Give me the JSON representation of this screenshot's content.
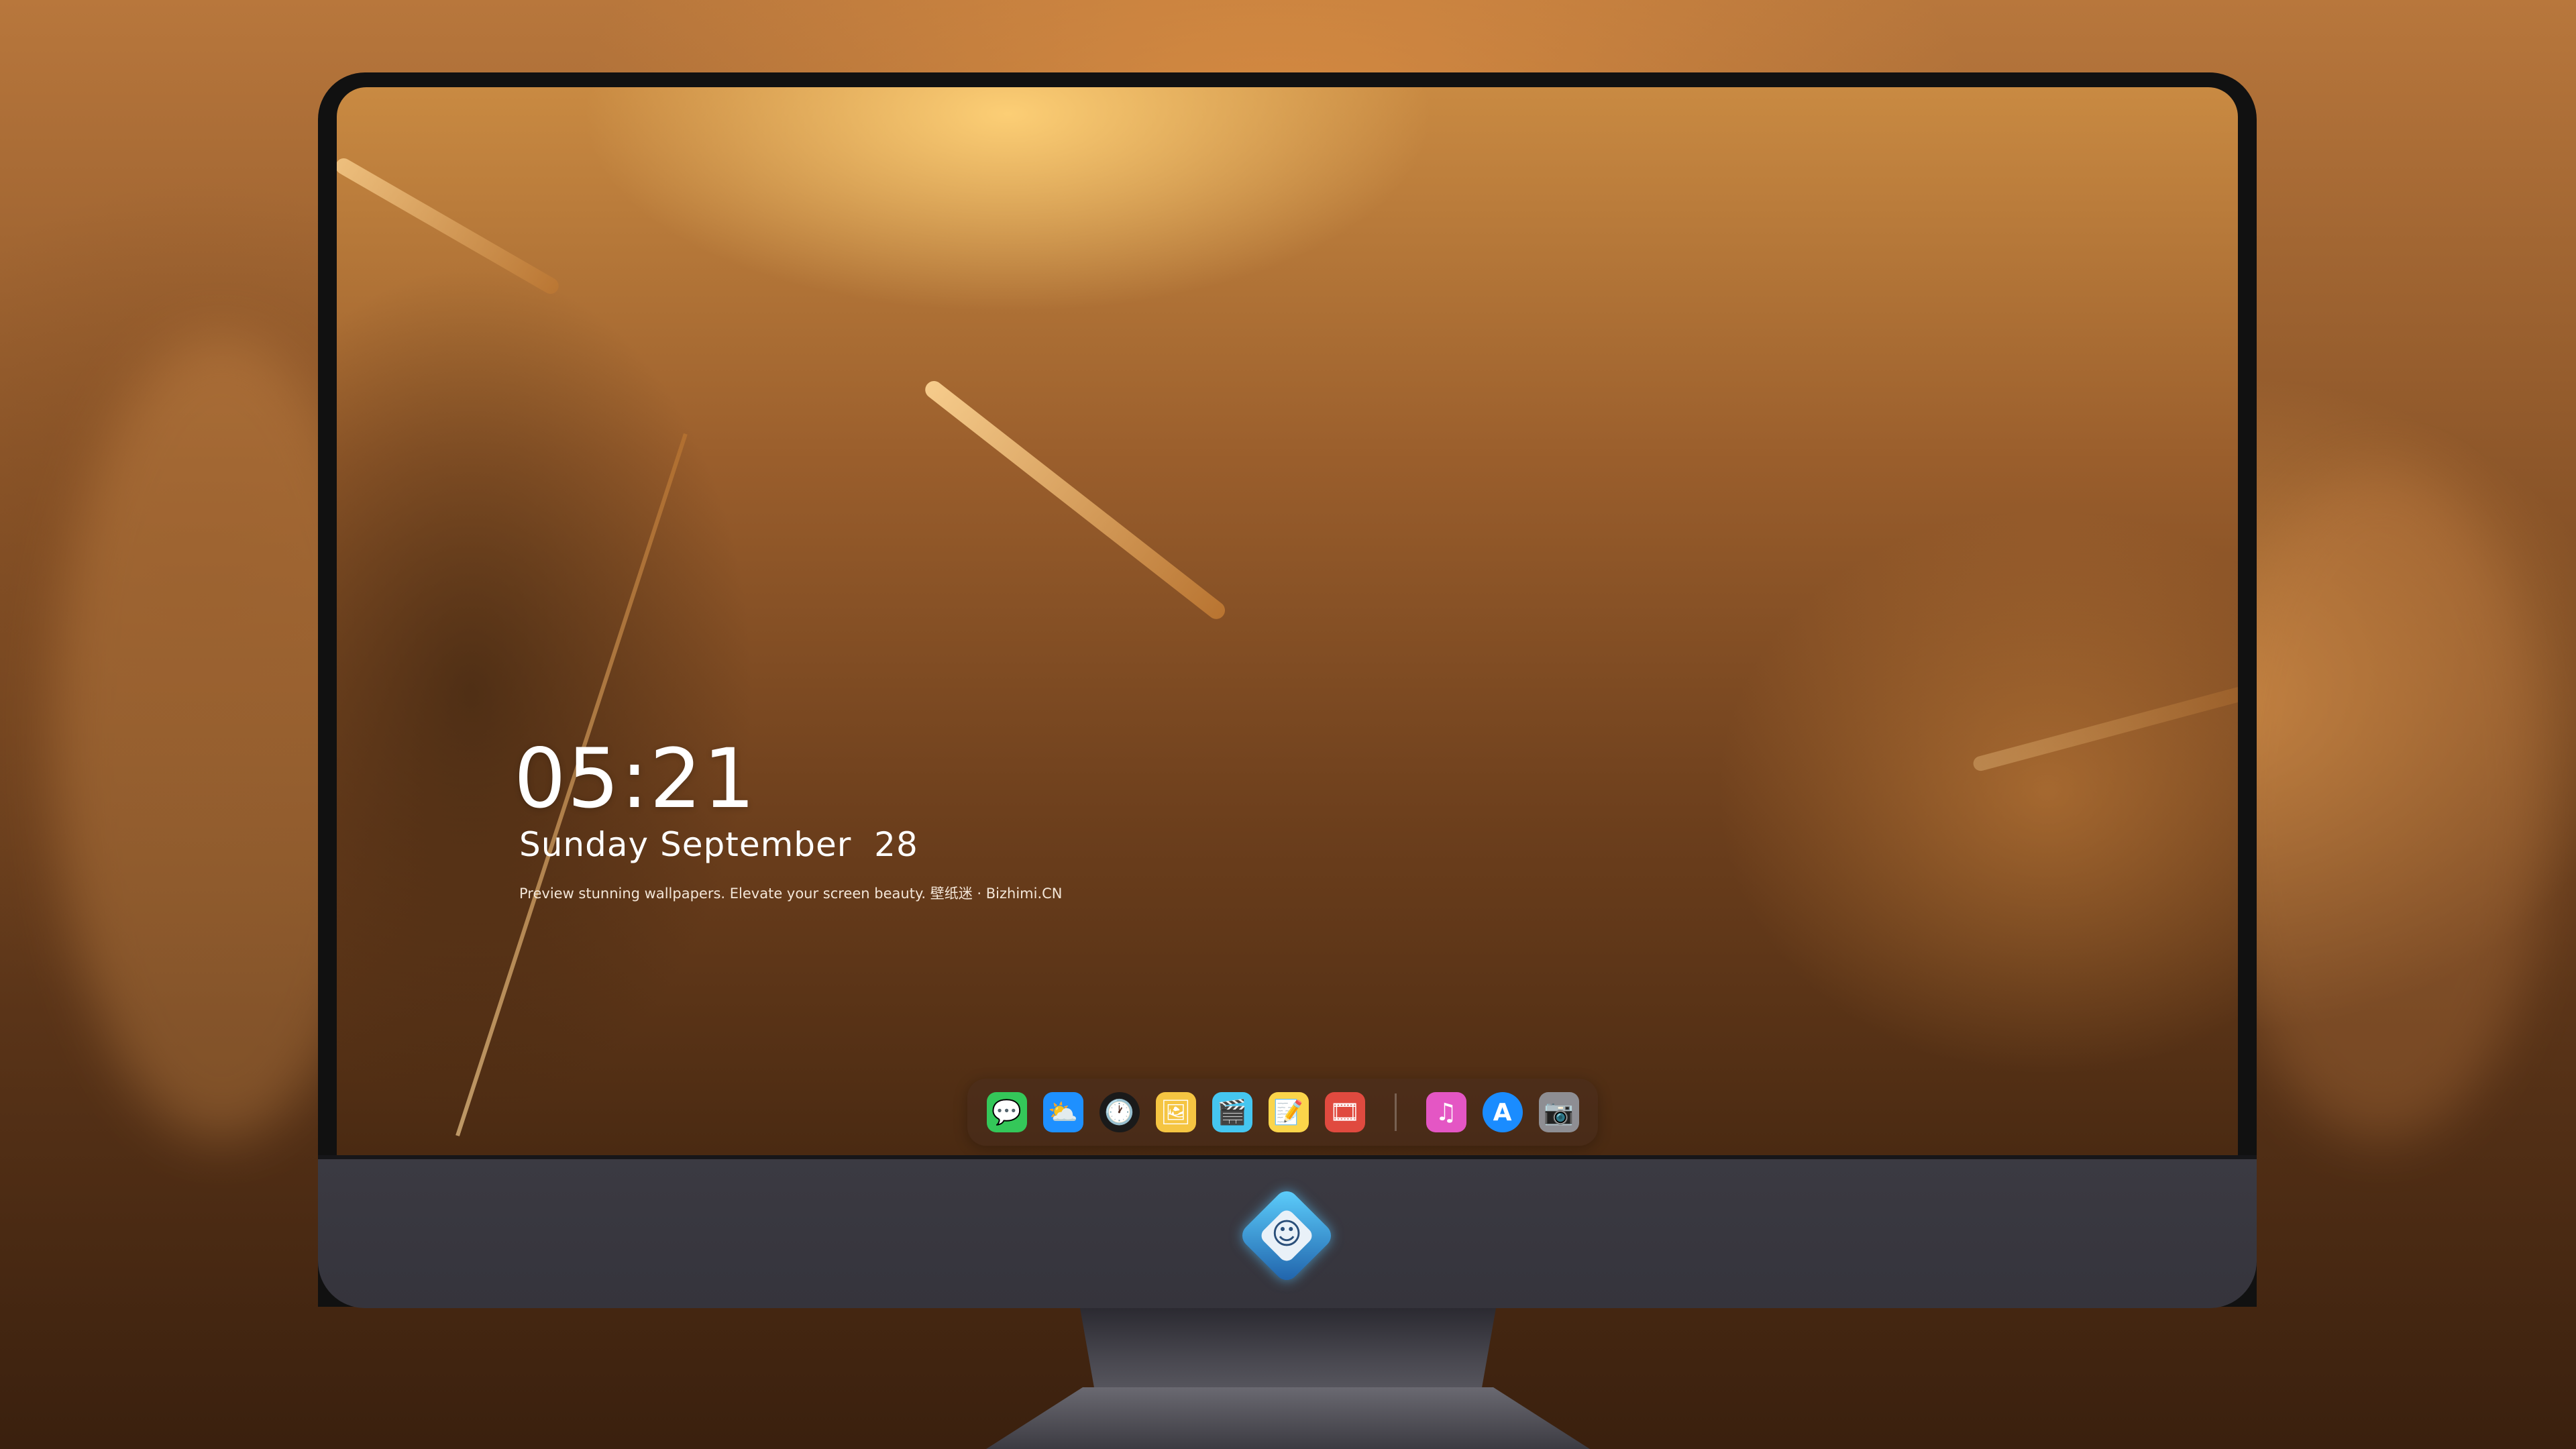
{
  "lock_screen": {
    "time": "05:21",
    "date": "Sunday September  28",
    "tagline": "Preview stunning wallpapers. Elevate your screen beauty. 壁纸迷 · Bizhimi.CN"
  },
  "dock": {
    "apps": [
      {
        "name": "Messages",
        "icon": "messages-icon",
        "glyph": "💬",
        "color": "#34c759"
      },
      {
        "name": "Weather",
        "icon": "weather-icon",
        "glyph": "⛅",
        "color": "#1e90ff"
      },
      {
        "name": "Clock",
        "icon": "clock-icon",
        "glyph": "🕐",
        "color": "#ffffff"
      },
      {
        "name": "Preview",
        "icon": "preview-icon",
        "glyph": "🖼",
        "color": "#f5c542"
      },
      {
        "name": "Clips",
        "icon": "clips-icon",
        "glyph": "🎬",
        "color": "#45c6f0"
      },
      {
        "name": "Notes",
        "icon": "notes-icon",
        "glyph": "📝",
        "color": "#fbd54a"
      },
      {
        "name": "Photo Booth",
        "icon": "photo-booth-icon",
        "glyph": "🎞",
        "color": "#e04a3f"
      },
      {
        "name": "Music",
        "icon": "music-icon",
        "glyph": "♫",
        "color": "#e456c4"
      },
      {
        "name": "App Store",
        "icon": "app-store-icon",
        "glyph": "A",
        "color": "#1a8cff"
      },
      {
        "name": "Camera",
        "icon": "camera-icon",
        "glyph": "📷",
        "color": "#8e8e93"
      }
    ]
  },
  "colors": {
    "accent": "#e7a04a",
    "chin": "#3b3a42"
  }
}
